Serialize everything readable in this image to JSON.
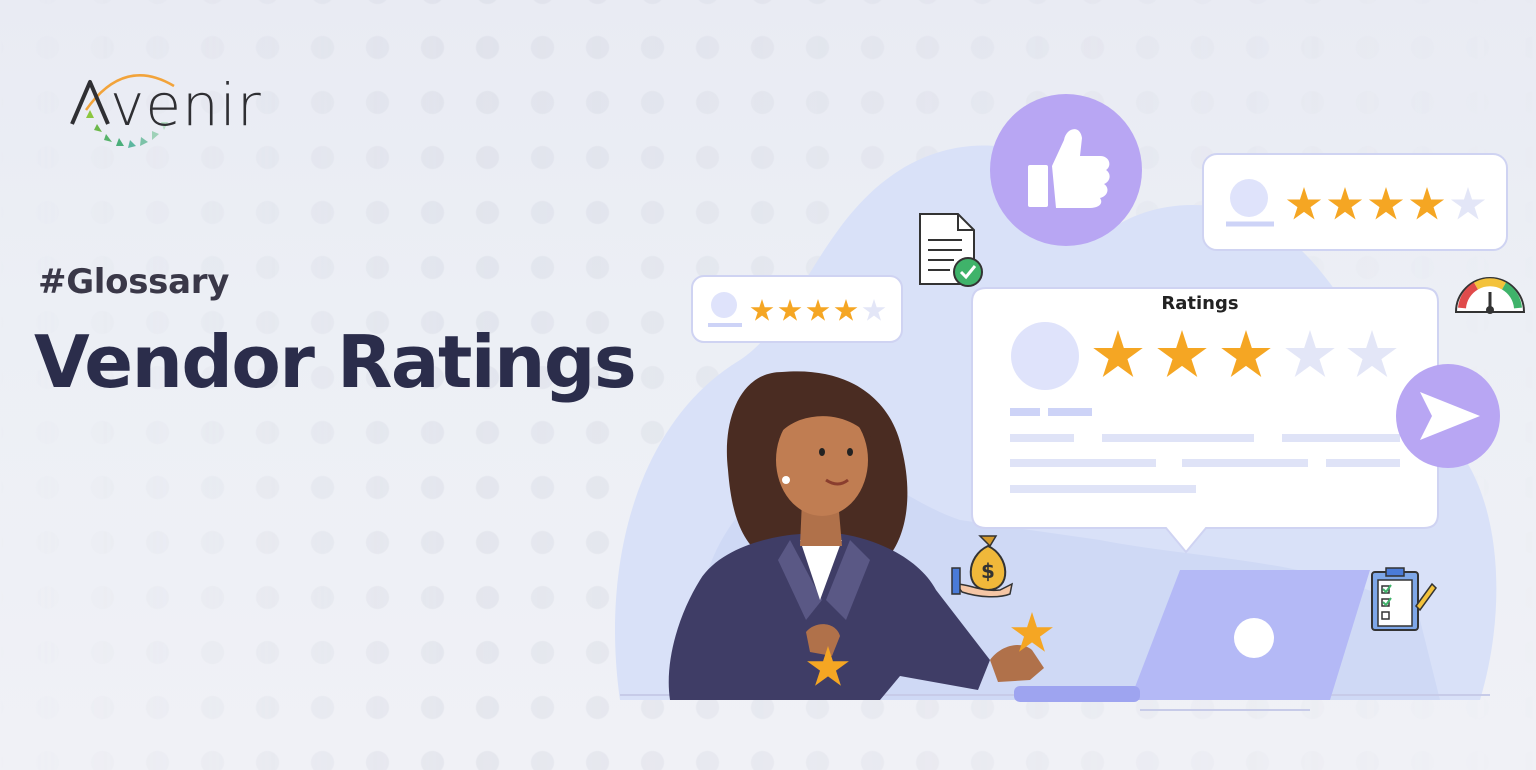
{
  "logo": {
    "text": "Aavenir",
    "display_text": "venir"
  },
  "eyebrow": "#Glossary",
  "headline": "Vendor Ratings",
  "main_card": {
    "title": "Ratings",
    "stars_filled": 3,
    "stars_total": 5
  },
  "small_card_left": {
    "stars_filled": 4,
    "stars_total": 5
  },
  "small_card_right": {
    "stars_filled": 4,
    "stars_total": 5
  },
  "colors": {
    "background": "#eceff5",
    "headline": "#2b2d4b",
    "star": "#f5a623",
    "star_empty": "#e3e6f7",
    "accent_purple": "#b9a9f2",
    "blob": "#d6def7",
    "laptop": "#b4b9f6"
  },
  "icons": [
    "thumbs-up-icon",
    "document-check-icon",
    "gauge-icon",
    "send-icon",
    "money-bag-icon",
    "checklist-icon"
  ]
}
